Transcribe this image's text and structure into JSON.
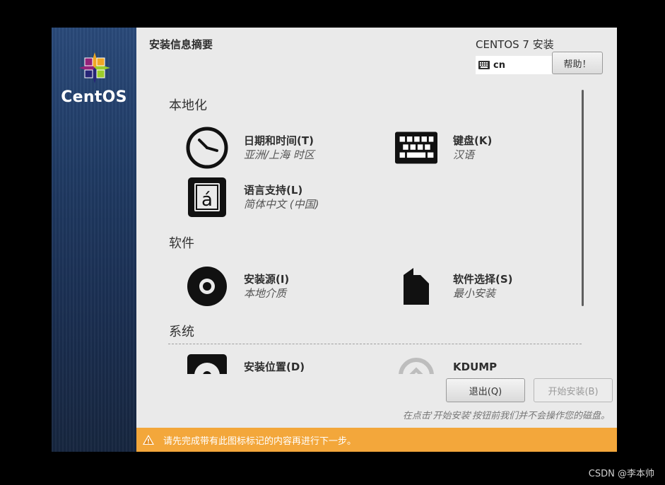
{
  "sidebar": {
    "brand": "CentOS"
  },
  "header": {
    "title": "安装信息摘要",
    "product": "CENTOS 7 安装",
    "keyboard_layout": "cn",
    "help_label": "帮助！"
  },
  "sections": {
    "localization": {
      "title": "本地化",
      "datetime": {
        "name": "日期和时间(T)",
        "status": "亚洲/上海 时区"
      },
      "keyboard": {
        "name": "键盘(K)",
        "status": "汉语"
      },
      "language": {
        "name": "语言支持(L)",
        "status": "简体中文 (中国)"
      }
    },
    "software": {
      "title": "软件",
      "source": {
        "name": "安装源(I)",
        "status": "本地介质"
      },
      "selection": {
        "name": "软件选择(S)",
        "status": "最小安装"
      }
    },
    "system": {
      "title": "系统",
      "destination": {
        "name": "安装位置(D)"
      },
      "kdump": {
        "name": "KDUMP"
      }
    }
  },
  "footer": {
    "quit_label": "退出(Q)",
    "begin_label": "开始安装(B)",
    "note": "在点击'开始安装'按钮前我们并不会操作您的磁盘。"
  },
  "warning": {
    "text": "请先完成带有此图标标记的内容再进行下一步。"
  },
  "watermark": "CSDN @李本帅",
  "colors": {
    "warning_bar": "#f3a73b",
    "sidebar": "#1f3a63"
  }
}
